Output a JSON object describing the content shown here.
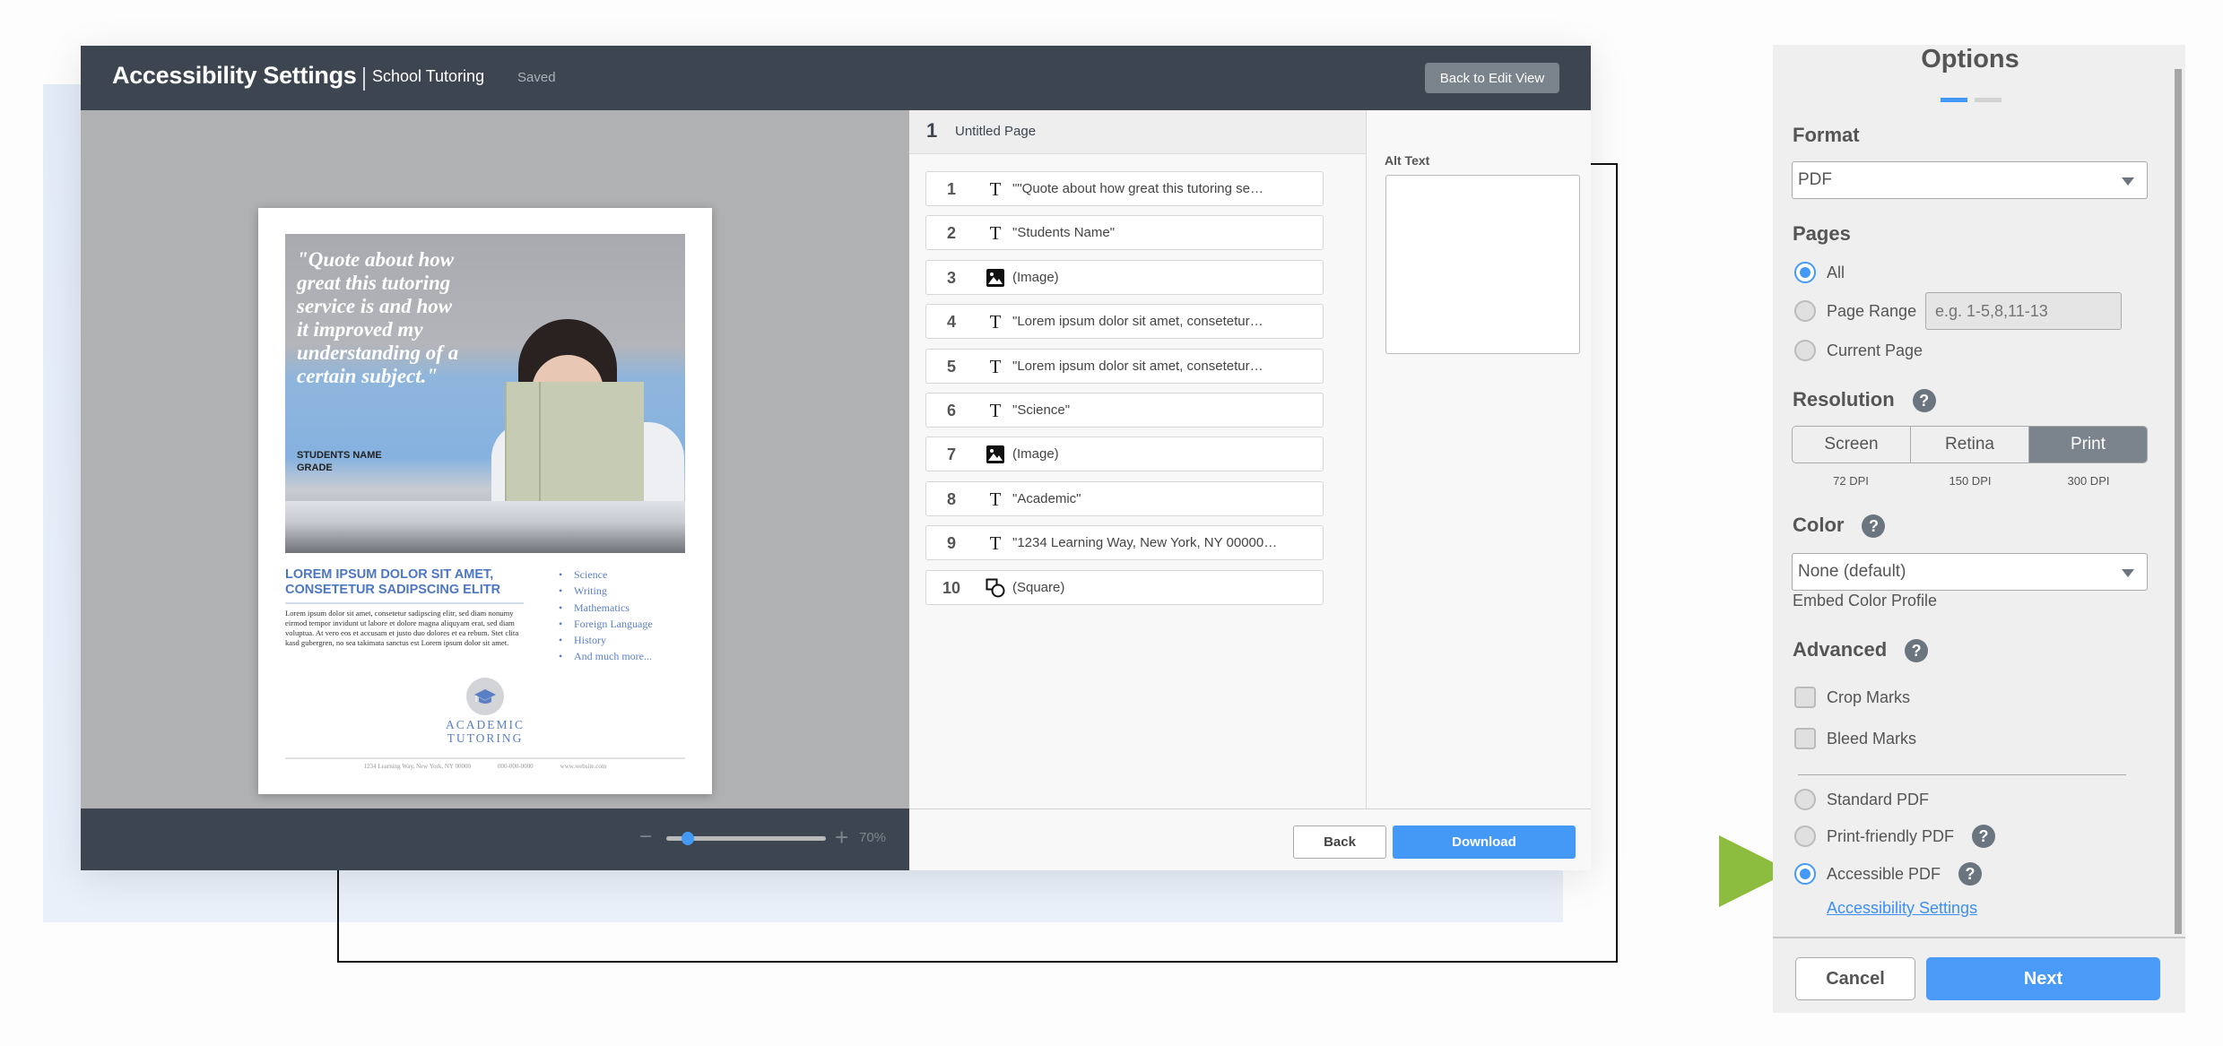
{
  "header": {
    "title": "Accessibility Settings",
    "document_name": "School Tutoring",
    "save_status": "Saved",
    "back_to_edit_label": "Back to Edit View"
  },
  "preview": {
    "zoom_minus": "−",
    "zoom_plus": "+",
    "zoom_percent": 70,
    "zoom_label": "70%",
    "zoom_slider_fraction": 0.1,
    "document": {
      "quote": "\"Quote about how great this tutoring service is and how it improved my understanding of a certain subject.\"",
      "student_name": "STUDENTS NAME",
      "grade": "GRADE",
      "heading": "LOREM IPSUM DOLOR SIT AMET, CONSETETUR SADIPSCING ELITR",
      "body": "Lorem ipsum dolor sit amet, consetetur sadipscing elitr, sed diam nonumy eirmod tempor invidunt ut labore et dolore magna aliquyam erat, sed diam voluptua. At vero eos et accusam et justo duo dolores et ea rebum. Stet clita kasd gubergren, no sea takimata sanctus est Lorem ipsum dolor sit amet.",
      "subjects": [
        "Science",
        "Writing",
        "Mathematics",
        "Foreign Language",
        "History",
        "And much more..."
      ],
      "logo_line1": "ACADEMIC",
      "logo_line2": "TUTORING",
      "footer_address": "1234 Learning Way, New York, NY 00000",
      "footer_phone": "000-000-0000",
      "footer_website": "www.website.com"
    }
  },
  "element_list": {
    "page_number": "1",
    "page_title": "Untitled Page",
    "items": [
      {
        "num": "1",
        "icon": "text-icon",
        "label": "\"\"Quote about how great this tutoring se…"
      },
      {
        "num": "2",
        "icon": "text-icon",
        "label": "\"Students Name\""
      },
      {
        "num": "3",
        "icon": "image-icon",
        "label": "(Image)"
      },
      {
        "num": "4",
        "icon": "text-icon",
        "label": "\"Lorem ipsum dolor sit amet, consetetur…"
      },
      {
        "num": "5",
        "icon": "text-icon",
        "label": "\"Lorem ipsum dolor sit amet, consetetur…"
      },
      {
        "num": "6",
        "icon": "text-icon",
        "label": "\"Science\""
      },
      {
        "num": "7",
        "icon": "image-icon",
        "label": "(Image)"
      },
      {
        "num": "8",
        "icon": "text-icon",
        "label": "\"Academic\""
      },
      {
        "num": "9",
        "icon": "text-icon",
        "label": "\"1234 Learning Way, New York, NY 00000…"
      },
      {
        "num": "10",
        "icon": "shape-icon",
        "label": "(Square)"
      }
    ]
  },
  "alt_text": {
    "label": "Alt Text",
    "value": ""
  },
  "footer": {
    "back_label": "Back",
    "download_label": "Download"
  },
  "options": {
    "title": "Options",
    "steps": {
      "current": 1,
      "total": 2
    },
    "format": {
      "label": "Format",
      "value": "PDF"
    },
    "pages": {
      "label": "Pages",
      "options": [
        "All",
        "Page Range",
        "Current Page"
      ],
      "selected": "All",
      "range_placeholder": "e.g. 1-5,8,11-13"
    },
    "resolution": {
      "label": "Resolution",
      "options": [
        {
          "label": "Screen",
          "dpi": "72 DPI"
        },
        {
          "label": "Retina",
          "dpi": "150 DPI"
        },
        {
          "label": "Print",
          "dpi": "300 DPI"
        }
      ],
      "selected": "Print"
    },
    "color": {
      "label": "Color",
      "value": "None (default)",
      "sublabel": "Embed Color Profile"
    },
    "advanced": {
      "label": "Advanced",
      "checkboxes": [
        {
          "label": "Crop Marks",
          "checked": false
        },
        {
          "label": "Bleed Marks",
          "checked": false
        }
      ],
      "pdf_types": [
        "Standard PDF",
        "Print-friendly PDF",
        "Accessible PDF"
      ],
      "selected_pdf_type": "Accessible PDF",
      "accessibility_link": "Accessibility Settings"
    },
    "help_glyph": "?",
    "cancel_label": "Cancel",
    "next_label": "Next"
  },
  "colors": {
    "accent": "#4499f7",
    "header_dark": "#3d4650",
    "pointer_arrow": "#8cbd3f"
  }
}
